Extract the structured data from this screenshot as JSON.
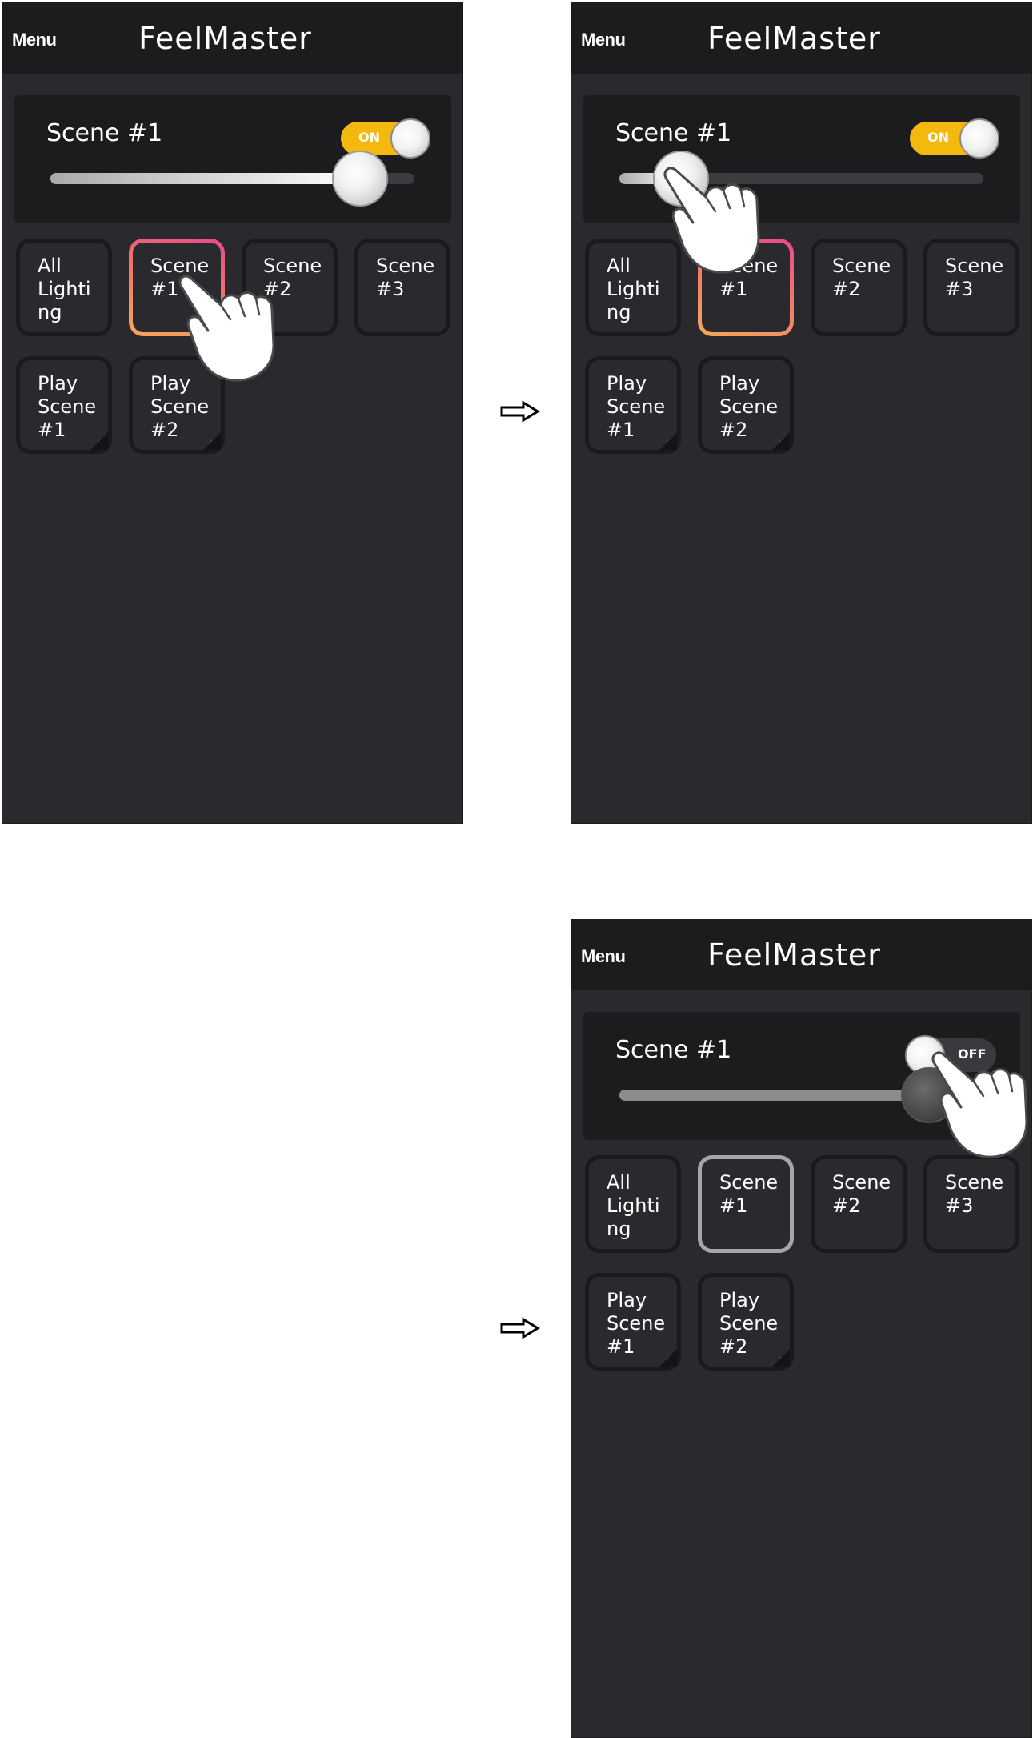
{
  "screens": [
    {
      "menu_label": "Menu",
      "title": "FeelMaster",
      "scene_name": "Scene #1",
      "toggle": {
        "label": "ON",
        "state": "on"
      },
      "dimmer_level": 0.85,
      "tiles": [
        {
          "line1": "All",
          "line2": "Lighti",
          "line3": "ng"
        },
        {
          "line1": "Scene",
          "line2": "#1",
          "line3": ""
        },
        {
          "line1": "Scene",
          "line2": "#2",
          "line3": ""
        },
        {
          "line1": "Scene",
          "line2": "#3",
          "line3": ""
        },
        {
          "line1": "Play",
          "line2": "Scene",
          "line3": "#1"
        },
        {
          "line1": "Play",
          "line2": "Scene",
          "line3": "#2"
        }
      ],
      "touch_target": "scene-1-tile"
    },
    {
      "menu_label": "Menu",
      "title": "FeelMaster",
      "scene_name": "Scene #1",
      "toggle": {
        "label": "ON",
        "state": "on"
      },
      "dimmer_level": 0.17,
      "tiles": [
        {
          "line1": "All",
          "line2": "Lighti",
          "line3": "ng"
        },
        {
          "line1": "Scene",
          "line2": "#1",
          "line3": ""
        },
        {
          "line1": "Scene",
          "line2": "#2",
          "line3": ""
        },
        {
          "line1": "Scene",
          "line2": "#3",
          "line3": ""
        },
        {
          "line1": "Play",
          "line2": "Scene",
          "line3": "#1"
        },
        {
          "line1": "Play",
          "line2": "Scene",
          "line3": "#2"
        }
      ],
      "touch_target": "dimmer-slider-knob"
    },
    {
      "menu_label": "Menu",
      "title": "FeelMaster",
      "scene_name": "Scene #1",
      "toggle": {
        "label": "OFF",
        "state": "off"
      },
      "dimmer_level": 0.85,
      "tiles": [
        {
          "line1": "All",
          "line2": "Lighti",
          "line3": "ng"
        },
        {
          "line1": "Scene",
          "line2": "#1",
          "line3": ""
        },
        {
          "line1": "Scene",
          "line2": "#2",
          "line3": ""
        },
        {
          "line1": "Scene",
          "line2": "#3",
          "line3": ""
        },
        {
          "line1": "Play",
          "line2": "Scene",
          "line3": "#1"
        },
        {
          "line1": "Play",
          "line2": "Scene",
          "line3": "#2"
        }
      ],
      "touch_target": "power-toggle"
    }
  ],
  "step_arrow_icon": "hollow-right-arrow",
  "colors": {
    "background": "#2a2a2e",
    "header": "#1c1c1e",
    "toggle_on": "#f5b80f",
    "active_tile_gradient": [
      "#e84a8a",
      "#f5a85a"
    ],
    "active_tile_off": "#a6a6a6"
  }
}
